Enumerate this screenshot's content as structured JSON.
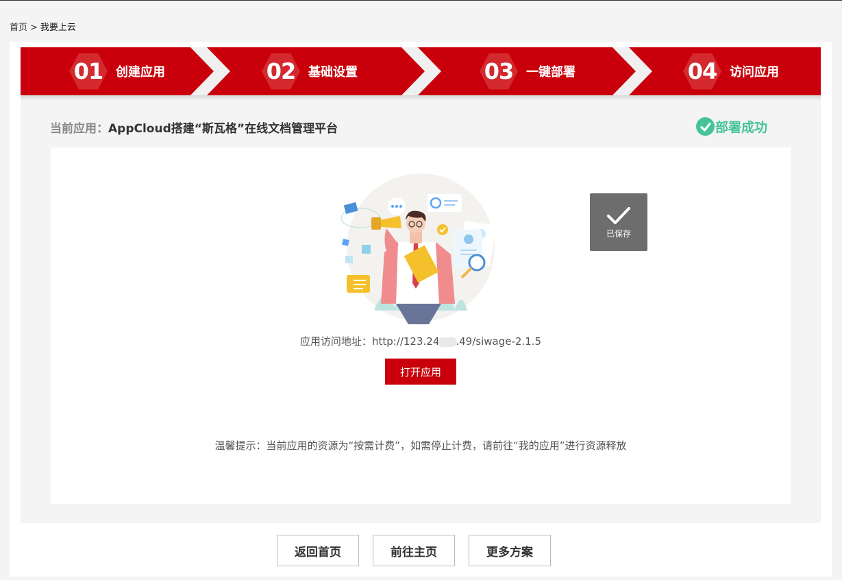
{
  "breadcrumb": {
    "home": "首页",
    "separator": ">",
    "current": "我要上云"
  },
  "steps": [
    {
      "num": "01",
      "label": "创建应用"
    },
    {
      "num": "02",
      "label": "基础设置"
    },
    {
      "num": "03",
      "label": "一键部署"
    },
    {
      "num": "04",
      "label": "访问应用"
    }
  ],
  "app": {
    "prefix": "当前应用：",
    "name": "AppCloud搭建“斯瓦格”在线文档管理平台",
    "status": "部署成功"
  },
  "saved_badge": "已保存",
  "address": {
    "label": "应用访问地址：",
    "url_start": "http://123.24",
    "url_end": ".49/siwage-2.1.5"
  },
  "open_button": "打开应用",
  "tip": "温馨提示：当前应用的资源为“按需计费”，如需停止计费，请前往“我的应用”进行资源释放",
  "buttons": {
    "back_home": "返回首页",
    "go_main": "前往主页",
    "more_plans": "更多方案"
  },
  "colors": {
    "brand_red": "#c9000b",
    "success_green": "#44c39b"
  }
}
